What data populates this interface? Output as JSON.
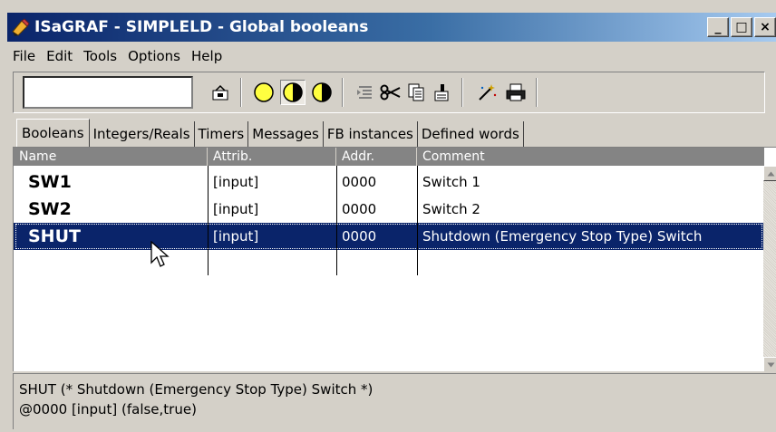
{
  "window": {
    "title": "ISaGRAF - SIMPLELD - Global booleans",
    "minimize_glyph": "_",
    "maximize_glyph": "□",
    "close_glyph": "×"
  },
  "menu": [
    "File",
    "Edit",
    "Tools",
    "Options",
    "Help"
  ],
  "toolbar": {
    "search_value": "",
    "icons": [
      "open-icon",
      "circle-empty-icon",
      "circle-half-icon",
      "circle-quarter-icon",
      "indent-icon",
      "cut-icon",
      "copy-icon",
      "paste-icon",
      "wand-icon",
      "print-icon"
    ]
  },
  "tabs": [
    {
      "label": "Booleans",
      "active": true
    },
    {
      "label": "Integers/Reals",
      "active": false
    },
    {
      "label": "Timers",
      "active": false
    },
    {
      "label": "Messages",
      "active": false
    },
    {
      "label": "FB instances",
      "active": false
    },
    {
      "label": "Defined words",
      "active": false
    }
  ],
  "table": {
    "columns": [
      "Name",
      "Attrib.",
      "Addr.",
      "Comment"
    ],
    "rows": [
      {
        "name": "SW1",
        "attrib": "[input]",
        "addr": "0000",
        "comment": "Switch 1",
        "selected": false
      },
      {
        "name": "SW2",
        "attrib": "[input]",
        "addr": "0000",
        "comment": "Switch 2",
        "selected": false
      },
      {
        "name": "SHUT",
        "attrib": "[input]",
        "addr": "0000",
        "comment": "Shutdown (Emergency Stop Type) Switch",
        "selected": true
      }
    ]
  },
  "status": {
    "line1": "SHUT   (* Shutdown (Emergency Stop Type) Switch *)",
    "line2": "@0000  [input]  (false,true)"
  },
  "colors": {
    "title_start": "#0a246a",
    "title_end": "#a6caf0",
    "selection": "#0a246a",
    "header_bg": "#848484",
    "face": "#d4d0c8"
  }
}
